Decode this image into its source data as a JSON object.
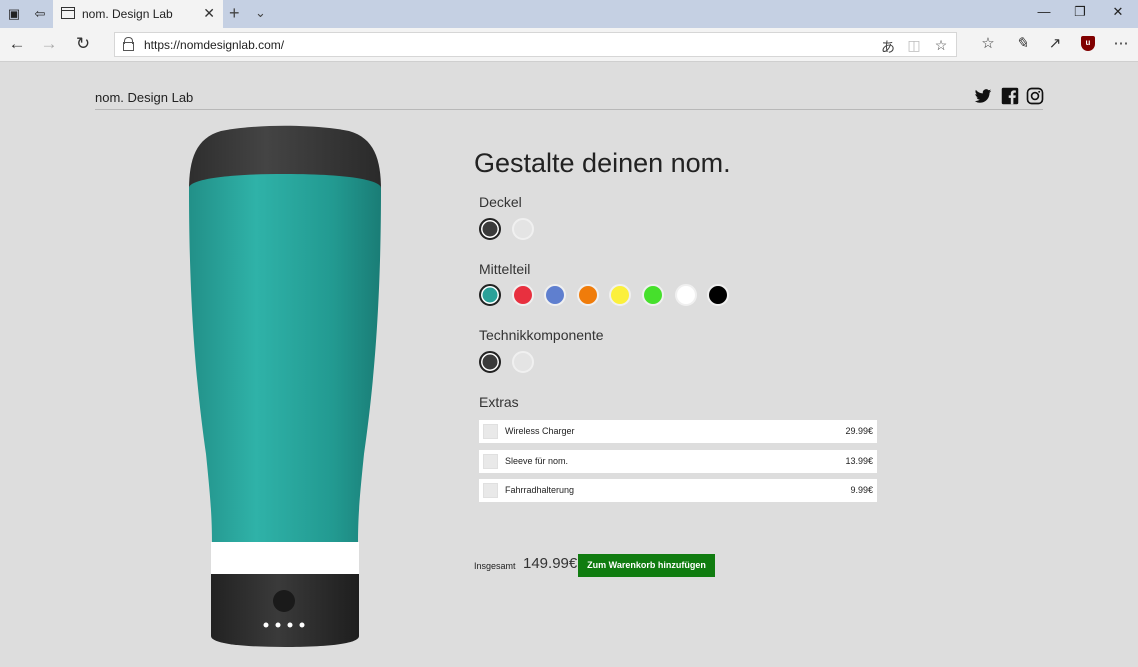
{
  "browser": {
    "tab_title": "nom. Design Lab",
    "url": "https://nomdesignlab.com/"
  },
  "site": {
    "title": "nom. Design Lab",
    "social_icons": [
      "twitter-icon",
      "facebook-icon",
      "instagram-icon"
    ]
  },
  "config": {
    "headline": "Gestalte deinen nom.",
    "sections": {
      "deckel": {
        "label": "Deckel",
        "colors": [
          "#3a3a3a",
          "#e4e4e4"
        ],
        "selected": 0
      },
      "mittelteil": {
        "label": "Mittelteil",
        "colors": [
          "#2aa199",
          "#e8303f",
          "#5f7fcf",
          "#f07c0a",
          "#fbf03c",
          "#46e02c",
          "#ffffff",
          "#000000"
        ],
        "selected": 0
      },
      "technik": {
        "label": "Technikkomponente",
        "colors": [
          "#3a3a3a",
          "#e4e4e4"
        ],
        "selected": 0
      }
    },
    "extras": {
      "label": "Extras",
      "items": [
        {
          "name": "Wireless Charger",
          "price": "29.99€"
        },
        {
          "name": "Sleeve für nom.",
          "price": "13.99€"
        },
        {
          "name": "Fahrradhalterung",
          "price": "9.99€"
        }
      ]
    },
    "total": {
      "label": "Insgesamt",
      "price": "149.99€",
      "button": "Zum Warenkorb hinzufügen"
    }
  },
  "colors": {
    "accent_button": "#107c10",
    "cup_body": "#2aa199",
    "cup_lid": "#3a3a3a",
    "page_background": "#dddddd"
  }
}
